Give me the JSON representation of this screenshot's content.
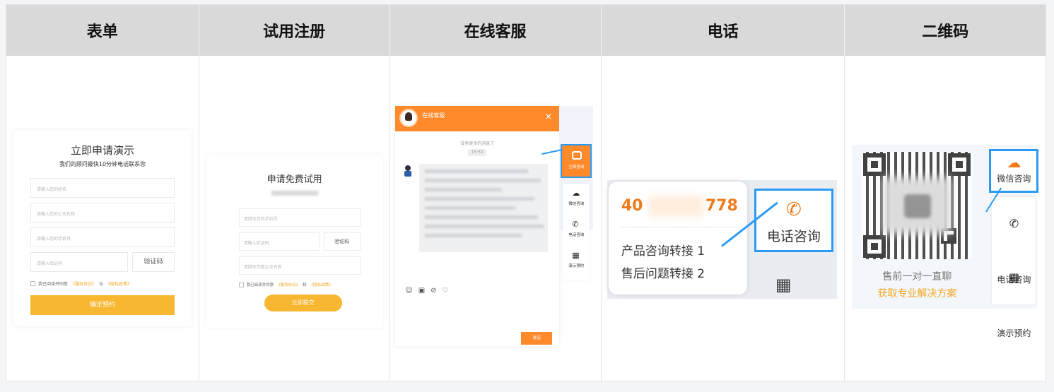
{
  "header": [
    "表单",
    "试用注册",
    "在线客服",
    "电话",
    "二维码"
  ],
  "form": {
    "title": "立即申请演示",
    "subtitle": "我们的顾问最快10分钟电话联系您",
    "name_ph": "请输入您的姓名",
    "company_ph": "请输入您的公司名称",
    "phone_ph": "请输入您的手机号",
    "code_ph": "请输入验证码",
    "code_btn": "验证码",
    "agree_pre": "我已阅读并同意",
    "agree_link1": "《服务协议》",
    "agree_mid": "与",
    "agree_link2": "《隐私政策》",
    "submit": "确定预约"
  },
  "trial": {
    "title": "申请免费试用",
    "phone_ph": "请填写您的手机号",
    "code_ph": "请输入验证码",
    "code_btn": "验证码",
    "company_ph": "请填写完整企业名称",
    "agree_pre": "我已阅读并同意",
    "agree_link1": "《服务协议》",
    "agree_mid": "和",
    "agree_link2": "《隐私政策》",
    "submit": "立即提交"
  },
  "chat": {
    "title": "在线客服",
    "close": "×",
    "no_more": "没有更多的消息了",
    "time": "15:51",
    "send": "发送",
    "side_highlight": "立即咨询",
    "side_items": [
      "微信咨询",
      "电话咨询",
      "演示预约"
    ]
  },
  "phone": {
    "num_start": "40",
    "num_end": "778",
    "line1": "产品咨询转接 1",
    "line2": "售后问题转接 2",
    "button": "电话咨询"
  },
  "qr": {
    "caption": "售前一对一直聊",
    "link": "获取专业解决方案",
    "side_highlight": "微信咨询",
    "side_items": [
      "电话咨询",
      "演示预约"
    ]
  },
  "colors": {
    "accent_orange": "#ff8a2b",
    "accent_yellow": "#f7b731",
    "highlight_blue": "#2b9af3"
  }
}
